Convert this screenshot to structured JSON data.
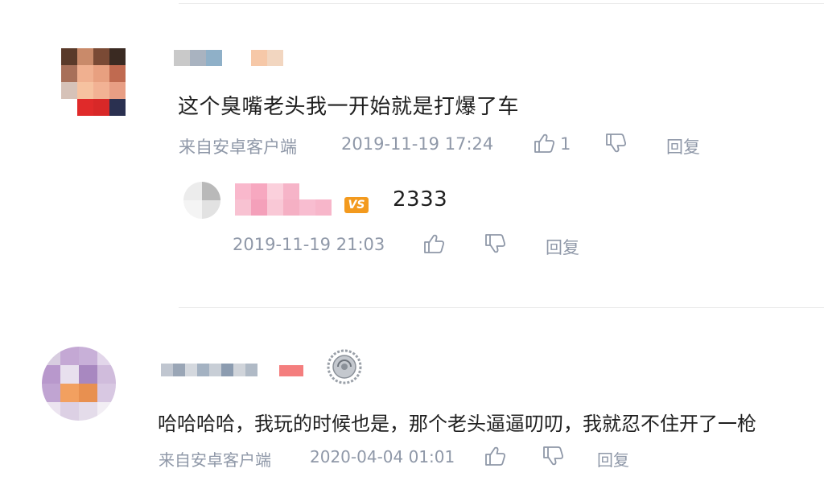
{
  "comments": [
    {
      "text": "这个臭嘴老头我一开始就是打爆了车",
      "source": "来自安卓客户端",
      "timestamp": "2019-11-19 17:24",
      "like_count": "1",
      "reply_label": "回复",
      "replies": [
        {
          "badge": "VS",
          "text": "2333",
          "timestamp": "2019-11-19 21:03",
          "reply_label": "回复"
        }
      ]
    },
    {
      "text": "哈哈哈哈，我玩的时候也是，那个老头逼逼叨叨，我就忍不住开了一枪",
      "source": "来自安卓客户端",
      "timestamp": "2020-04-04 01:01",
      "reply_label": "回复"
    }
  ],
  "icons": {
    "like": "thumbs-up-icon",
    "dislike": "thumbs-down-icon",
    "member_medal": "medal-icon"
  },
  "colors": {
    "meta_text": "#8f98a8",
    "badge_orange": "#f39a1e",
    "divider": "#e9e9e9"
  }
}
